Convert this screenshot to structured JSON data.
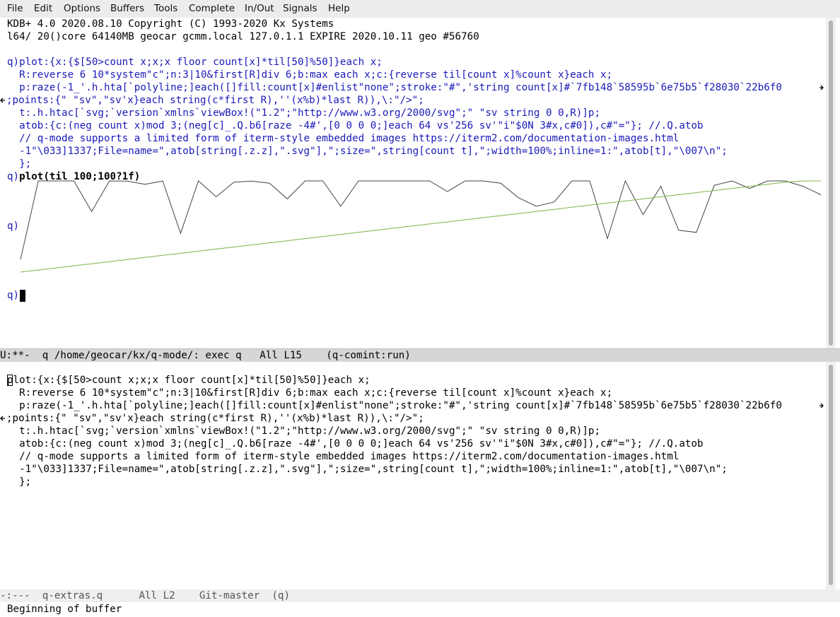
{
  "menubar": [
    "File",
    "Edit",
    "Options",
    "Buffers",
    "Tools",
    "Complete",
    "In/Out",
    "Signals",
    "Help"
  ],
  "top_pane": {
    "lines": [
      "KDB+ 4.0 2020.08.10 Copyright (C) 1993-2020 Kx Systems",
      "l64/ 20()core 64140MB geocar gcmm.local 127.0.1.1 EXPIRE 2020.10.11 geo #56760"
    ],
    "prompt": "q)",
    "code_first": "plot:{x:{$[50>count x;x;x floor count[x]*til[50]%50]}each x;",
    "code_rest": [
      "  R:reverse 6 10*system\"c\";n:3|10&first[R]div 6;b:max each x;c:{reverse til[count x]%count x}each x;",
      "  p:raze(-1_'.h.hta[`polyline;]each([]fill:count[x]#enlist\"none\";stroke:\"#\",'string count[x]#`7fb148`58595b`6e75b5`f28030`22b6f0",
      ";points:{\" \"sv\",\"sv'x}each string(c*first R),''(x%b)*last R)),\\:\"/>\";",
      "  t:.h.htac[`svg;`version`xmlns`viewBox!(\"1.2\";\"http://www.w3.org/2000/svg\";\" \"sv string 0 0,R)]p;",
      "  atob:{c:(neg count x)mod 3;(neg[c]_.Q.b6[raze -4#',[0 0 0 0;]each 64 vs'256 sv'\"i\"$0N 3#x,c#0]),c#\"=\"}; //.Q.atob",
      "  // q-mode supports a limited form of iterm-style embedded images https://iterm2.com/documentation-images.html",
      "  -1\"\\033]1337;File=name=\",atob[string[.z.z],\".svg\"],\";size=\",string[count t],\";width=100%;inline=1:\",atob[t],\"\\007\\n\";",
      "  };"
    ],
    "command": "plot(til 100;100?1f)"
  },
  "plot": {
    "series": [
      {
        "color": "#444444",
        "values": [
          0.12,
          0.88,
          0.91,
          0.98,
          0.58,
          0.99,
          0.87,
          0.84,
          0.87,
          0.37,
          0.98,
          0.72,
          0.86,
          0.87,
          0.85,
          0.7,
          1.15,
          1.11,
          0.63,
          0.97,
          1.01,
          1.02,
          0.9,
          0.89,
          0.77,
          0.97,
          1.11,
          0.85,
          0.71,
          0.63,
          0.67,
          0.95,
          0.92,
          0.32,
          0.88,
          0.55,
          0.82,
          0.4,
          0.38,
          0.83,
          0.94,
          0.8,
          0.89,
          1.09,
          0.82,
          0.74
        ]
      },
      {
        "color": "#7fb148",
        "values": [
          0.0,
          0.02,
          0.04,
          0.06,
          0.08,
          0.1,
          0.12,
          0.14,
          0.16,
          0.18,
          0.2,
          0.22,
          0.24,
          0.26,
          0.28,
          0.3,
          0.32,
          0.34,
          0.36,
          0.38,
          0.4,
          0.42,
          0.44,
          0.46,
          0.48,
          0.5,
          0.52,
          0.54,
          0.56,
          0.58,
          0.6,
          0.62,
          0.64,
          0.66,
          0.68,
          0.7,
          0.72,
          0.74,
          0.76,
          0.78,
          0.8,
          0.82,
          0.84,
          0.86,
          0.88,
          0.9
        ]
      }
    ]
  },
  "modeline_top": "U:**-  q /home/geocar/kx/q-mode/: exec q   All L15    (q-comint:run)",
  "bottom_pane": {
    "lines": [
      "plot:{x:{$[50>count x;x;x floor count[x]*til[50]%50]}each x;",
      "  R:reverse 6 10*system\"c\";n:3|10&first[R]div 6;b:max each x;c:{reverse til[count x]%count x}each x;",
      "  p:raze(-1_'.h.hta[`polyline;]each([]fill:count[x]#enlist\"none\";stroke:\"#\",'string count[x]#`7fb148`58595b`6e75b5`f28030`22b6f0",
      ";points:{\" \"sv\",\"sv'x}each string(c*first R),''(x%b)*last R)),\\:\"/>\";",
      "  t:.h.htac[`svg;`version`xmlns`viewBox!(\"1.2\";\"http://www.w3.org/2000/svg\";\" \"sv string 0 0,R)]p;",
      "  atob:{c:(neg count x)mod 3;(neg[c]_.Q.b6[raze -4#',[0 0 0 0;]each 64 vs'256 sv'\"i\"$0N 3#x,c#0]),c#\"=\"}; //.Q.atob",
      "  // q-mode supports a limited form of iterm-style embedded images https://iterm2.com/documentation-images.html",
      "  -1\"\\033]1337;File=name=\",atob[string[.z.z],\".svg\"],\";size=\",string[count t],\";width=100%;inline=1:\",atob[t],\"\\007\\n\";",
      "  };"
    ]
  },
  "modeline_bottom": "-:---  q-extras.q      All L2    Git-master  (q)",
  "echo_area": "Beginning of buffer"
}
